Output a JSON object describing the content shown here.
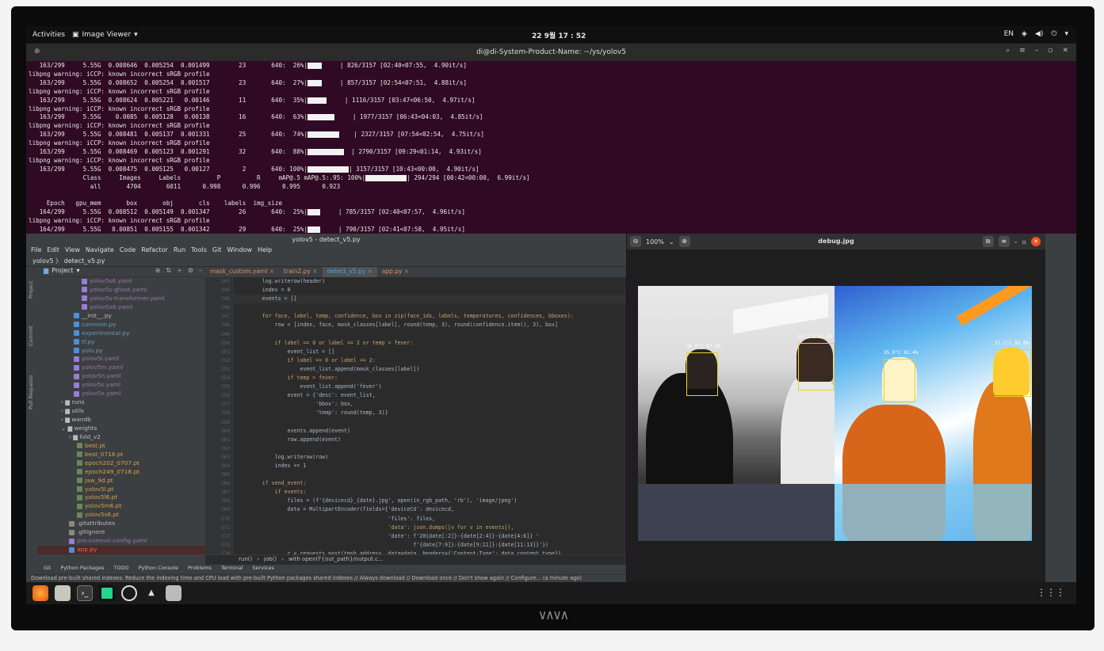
{
  "topbar": {
    "activities": "Activities",
    "app": "Image Viewer",
    "clock": "22 9월 17 : 52",
    "lang": "EN"
  },
  "terminal": {
    "title": "di@di-System-Product-Name: ~/ys/yolov5",
    "lines": [
      {
        "text": "   163/299     5.55G  0.008646  0.005254  0.001499        23       640:  26%|",
        "bar": 18,
        "tail": "     | 826/3157 [02:40<07:55,  4.90it/s]"
      },
      {
        "text": "libpng warning: iCCP: known incorrect sRGB profile"
      },
      {
        "text": "   163/299     5.55G  0.008652  0.005254  0.001517        23       640:  27%|",
        "bar": 18,
        "tail": "     | 857/3157 [02:54<07:51,  4.88it/s]"
      },
      {
        "text": "libpng warning: iCCP: known incorrect sRGB profile"
      },
      {
        "text": "   163/299     5.55G  0.008624  0.005221   0.00146        11       640:  35%|",
        "bar": 24,
        "tail": "     | 1116/3157 [03:47<06:50,  4.97it/s]"
      },
      {
        "text": "libpng warning: iCCP: known incorrect sRGB profile"
      },
      {
        "text": "   163/299     5.55G    0.0085  0.005128   0.00138        16       640:  63%|",
        "bar": 34,
        "tail": "     | 1977/3157 [06:43<04:03,  4.85it/s]"
      },
      {
        "text": "libpng warning: iCCP: known incorrect sRGB profile"
      },
      {
        "text": "   163/299     5.55G  0.008481  0.005137  0.001331        25       640:  74%|",
        "bar": 40,
        "tail": "    | 2327/3157 [07:54<02:54,  4.75it/s]"
      },
      {
        "text": "libpng warning: iCCP: known incorrect sRGB profile"
      },
      {
        "text": "   163/299     5.55G  0.008469  0.005123  0.001291        32       640:  88%|",
        "bar": 46,
        "tail": "  | 2790/3157 [09:29<01:14,  4.93it/s]"
      },
      {
        "text": "libpng warning: iCCP: known incorrect sRGB profile"
      },
      {
        "text": "   163/299     5.55G  0.008475  0.005125   0.00127         2       640: 100%|",
        "bar": 52,
        "tail": "| 3157/3157 [10:43<00:00,  4.90it/s]"
      },
      {
        "text": "               Class     Images     Labels          P          R     mAP@.5 mAP@.5:.95: 100%|",
        "bar": 52,
        "tail": "| 294/294 [00:42<00:00,  6.99it/s]"
      },
      {
        "text": "                 all       4704       6011      0.998      0.996      0.995      0.923"
      },
      {
        "text": ""
      },
      {
        "text": "     Epoch   gpu_mem       box       obj       cls    labels  img_size"
      },
      {
        "text": "   164/299     5.55G  0.008512  0.005149  0.001347        26       640:  25%|",
        "bar": 16,
        "tail": "     | 785/3157 [02:40<07:57,  4.96it/s]"
      },
      {
        "text": "libpng warning: iCCP: known incorrect sRGB profile"
      },
      {
        "text": "   164/299     5.55G   0.00851  0.005155  0.001342        29       640:  25%|",
        "bar": 16,
        "tail": "     | 790/3157 [02:41<07:58,  4.95it/s]"
      },
      {
        "text": "libpng warning: iCCP: known incorrect sRGB profile"
      },
      {
        "text": "   164/299     5.55G  0.008478  0.005136  0.001265        19       640:  39%|",
        "bar": 22,
        "tail": "     | 1243/3157 [04:15<06:40,  4.78it/s]"
      },
      {
        "text": "libpng warning: iCCP: known incorrect sRGB profile"
      },
      {
        "text": "   164/299     5.55G  0.008486  0.005121  0.001245        15       640:  54%|",
        "bar": 28,
        "tail": "     | 1698/3157 [05:54<05:05,  4.77it/s]"
      }
    ]
  },
  "ide": {
    "title": "yolov5 - detect_v5.py",
    "menu": [
      "File",
      "Edit",
      "View",
      "Navigate",
      "Code",
      "Refactor",
      "Run",
      "Tools",
      "Git",
      "Window",
      "Help"
    ],
    "crumb": "yolov5 〉 detect_v5.py",
    "project_label": "Project",
    "left_tabs": [
      "Project",
      "Commit",
      "Pull Requests"
    ],
    "tabs": [
      {
        "label": "mask_custom.yaml",
        "active": false
      },
      {
        "label": "train2.py",
        "active": false
      },
      {
        "label": "detect_v5.py",
        "active": true
      },
      {
        "label": "app.py",
        "active": false
      }
    ],
    "tree": [
      {
        "label": "yolov5s6.yaml",
        "indent": 56,
        "color": "#9c7cd6",
        "text": "#9876aa"
      },
      {
        "label": "yolov5s-ghost.yaml",
        "indent": 56,
        "color": "#9c7cd6",
        "text": "#9876aa"
      },
      {
        "label": "yolov5s-transformer.yaml",
        "indent": 56,
        "color": "#9c7cd6",
        "text": "#9876aa"
      },
      {
        "label": "yolov5x6.yaml",
        "indent": 56,
        "color": "#9c7cd6",
        "text": "#9876aa"
      },
      {
        "label": "__init__.py",
        "indent": 46,
        "color": "#4a90d9",
        "text": "#bbbbbb"
      },
      {
        "label": "common.py",
        "indent": 46,
        "color": "#4a90d9",
        "text": "#6897bb"
      },
      {
        "label": "experimental.py",
        "indent": 46,
        "color": "#4a90d9",
        "text": "#6897bb"
      },
      {
        "label": "tf.py",
        "indent": 46,
        "color": "#4a90d9",
        "text": "#6897bb"
      },
      {
        "label": "yolo.py",
        "indent": 46,
        "color": "#4a90d9",
        "text": "#6897bb"
      },
      {
        "label": "yolov5l.yaml",
        "indent": 46,
        "color": "#9c7cd6",
        "text": "#9876aa"
      },
      {
        "label": "yolov5m.yaml",
        "indent": 46,
        "color": "#9c7cd6",
        "text": "#9876aa"
      },
      {
        "label": "yolov5n.yaml",
        "indent": 46,
        "color": "#9c7cd6",
        "text": "#9876aa"
      },
      {
        "label": "yolov5s.yaml",
        "indent": 46,
        "color": "#9c7cd6",
        "text": "#9876aa"
      },
      {
        "label": "yolov5x.yaml",
        "indent": 46,
        "color": "#9c7cd6",
        "text": "#9876aa"
      },
      {
        "label": "› ▆ runs",
        "indent": 30,
        "color": "",
        "text": "#bbbbbb"
      },
      {
        "label": "› ▆ utils",
        "indent": 30,
        "color": "",
        "text": "#bbbbbb"
      },
      {
        "label": "› ▆ wandb",
        "indent": 30,
        "color": "",
        "text": "#bbbbbb"
      },
      {
        "label": "⌄ ▆ weights",
        "indent": 30,
        "color": "",
        "text": "#bbbbbb"
      },
      {
        "label": "› ▆ fold_v2",
        "indent": 40,
        "color": "",
        "text": "#bbbbbb"
      },
      {
        "label": "best.pt",
        "indent": 50,
        "color": "#6a8759",
        "text": "#d4a24a"
      },
      {
        "label": "best_0718.pt",
        "indent": 50,
        "color": "#6a8759",
        "text": "#d4a24a"
      },
      {
        "label": "epoch202_0707.pt",
        "indent": 50,
        "color": "#6a8759",
        "text": "#d4a24a"
      },
      {
        "label": "epoch249_0718.pt",
        "indent": 50,
        "color": "#6a8759",
        "text": "#d4a24a"
      },
      {
        "label": "jaw_9d.pt",
        "indent": 50,
        "color": "#6a8759",
        "text": "#d4a24a"
      },
      {
        "label": "yolov5l.pt",
        "indent": 50,
        "color": "#6a8759",
        "text": "#d4a24a"
      },
      {
        "label": "yolov5l6.pt",
        "indent": 50,
        "color": "#6a8759",
        "text": "#d4a24a"
      },
      {
        "label": "yolov5m6.pt",
        "indent": 50,
        "color": "#6a8759",
        "text": "#d4a24a"
      },
      {
        "label": "yolov5s6.pt",
        "indent": 50,
        "color": "#6a8759",
        "text": "#d4a24a"
      },
      {
        "label": ".gitattributes",
        "indent": 40,
        "color": "#888888",
        "text": "#bbbbbb"
      },
      {
        "label": ".gitignore",
        "indent": 40,
        "color": "#888888",
        "text": "#bbbbbb"
      },
      {
        "label": "pre-commit-config.yaml",
        "indent": 40,
        "color": "#9c7cd6",
        "text": "#9876aa"
      },
      {
        "label": "app.py",
        "indent": 40,
        "color": "#4a90d9",
        "text": "#e06c4c"
      }
    ],
    "line_numbers": [
      "243",
      "244",
      "245",
      "246",
      "247",
      "248",
      "249",
      "250",
      "251",
      "252",
      "253",
      "254",
      "255",
      "256",
      "257",
      "258",
      "259",
      "260",
      "261",
      "262",
      "263",
      "264",
      "265",
      "266",
      "267",
      "268",
      "269",
      "270",
      "271",
      "272",
      "273",
      "274"
    ],
    "code": [
      "        log.writerow(header)",
      "        index = 0",
      "        events = []",
      "",
      "        for face, label, temp, confidence, box in zip(face_ids, labels, temperatures, confidences, bboxes):",
      "            row = [index, face, mask_classes[label], round(temp, 3), round(confidence.item(), 3), box]",
      "",
      "            if label == 0 or label == 2 or temp > fever:",
      "                event_list = []",
      "                if label == 0 or label == 2:",
      "                    event_list.append(mask_classes[label])",
      "                if temp > fever:",
      "                    event_list.append('fever')",
      "                event = {'desc': event_list,",
      "                         'bbox': box,",
      "                         'temp': round(temp, 3)}",
      "",
      "                events.append(event)",
      "                row.append(event)",
      "",
      "            log.writerow(row)",
      "            index += 1",
      "",
      "        if send_event:",
      "            if events:",
      "                files = (f'{devicecd}_{date}.jpg', open(in_rgb_path, 'rb'), 'image/jpeg')",
      "                data = MultipartEncoder(fields={'deviceCd': devicecd,",
      "                                                'files': files,",
      "                                                'data': json.dumps([v for v in events]),",
      "                                                'date': f'20{date[:2]}-{date[2:4]}-{date[4:6]} '",
      "                                                        f'{date[7:9]}:{date[9:11]}:{date[11:13]}'})",
      "                r = requests.post(tmsh_address, data=data, headers={'Content-Type': data.content_type})"
    ],
    "code_crumb": [
      "run()",
      "›",
      "job()",
      "›",
      "with open(f'{out_path}/output.c..."
    ],
    "toolwindows": [
      "Git",
      "Python Packages",
      "TODO",
      "Python Console",
      "Problems",
      "Terminal",
      "Services"
    ],
    "status": "Download pre-built shared indexes: Reduce the indexing time and CPU load with pre-built Python packages shared indexes // Always download // Download once // Don't show again // Configure... (a minute ago)"
  },
  "viewer": {
    "zoom": "100%",
    "filename": "debug.jpg",
    "rgb_labels": [
      "36.0°C 92.4%",
      "37.1°C 92.0%"
    ],
    "thermal_labels": [
      "35.0°C 92.4%",
      "37.1°C 92.0%"
    ]
  },
  "dock": {
    "items": [
      "firefox-icon",
      "files-icon",
      "terminal-icon",
      "pycharm-icon",
      "settings-icon",
      "software-icon",
      "image-viewer-icon"
    ]
  },
  "colors": {
    "terminal_bg": "#300a24",
    "ide_bg": "#2b2b2b",
    "accent": "#e95420",
    "box": "#e8d22a"
  }
}
